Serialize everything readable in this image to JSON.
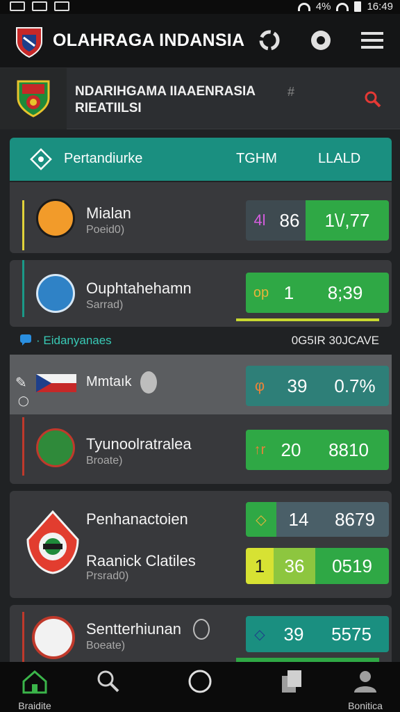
{
  "status": {
    "icons": [
      "notification-icon",
      "photo-icon",
      "message-icon"
    ],
    "right_text": "4% ",
    "time": "16:49"
  },
  "app": {
    "title": "OLAHRAGA INDANSIA",
    "actions": [
      "refresh-icon",
      "target-icon",
      "menu-icon"
    ]
  },
  "sub": {
    "title_line1": "NDARIHGAMA IIAAENRASIA",
    "title_line2": "RIEATIILSI",
    "grid_glyph": "#"
  },
  "table": {
    "header_label": "Pertandiurke",
    "col_team": "TGHM",
    "col_lead": "LLALD"
  },
  "rows": [
    {
      "name": "Mialan",
      "sub": "Poeid0)",
      "left": "4l",
      "mid": "86",
      "right": "1\\/,77"
    },
    {
      "name": "Ouphtahehamn",
      "sub": "Sarrad)",
      "left": "op",
      "mid": "1",
      "right": "8;39"
    },
    {
      "name": "Mmtaık",
      "sub": "",
      "left": "φ",
      "mid": "39",
      "right": "0.7%"
    },
    {
      "name": "Tyunoolratralea",
      "sub": "Broate)",
      "left": "↑r",
      "mid": "20",
      "right": "8810"
    },
    {
      "name": "Penhanactoien",
      "sub": "",
      "left": "◇",
      "mid": "14",
      "right": "8679"
    },
    {
      "name": "Raanick Clatiles",
      "sub": "Prsrad0)",
      "left": "1",
      "mid": "36",
      "right": "0519"
    },
    {
      "name": "Sentterhiunan",
      "sub": "Boeate)",
      "left": "◇",
      "mid": "39",
      "right": "5575"
    }
  ],
  "section": {
    "label": "· Eidanyanaes",
    "right": "0G5IR  30JCAVE"
  },
  "nav": {
    "items": [
      {
        "label": "Braidite"
      },
      {
        "label": ""
      },
      {
        "label": ""
      },
      {
        "label": ""
      },
      {
        "label": "Bonitica"
      }
    ]
  },
  "colors": {
    "teal": "#1a8f80",
    "green": "#2fa845",
    "lime": "#d7e233",
    "slate": "#2e4a4c"
  }
}
